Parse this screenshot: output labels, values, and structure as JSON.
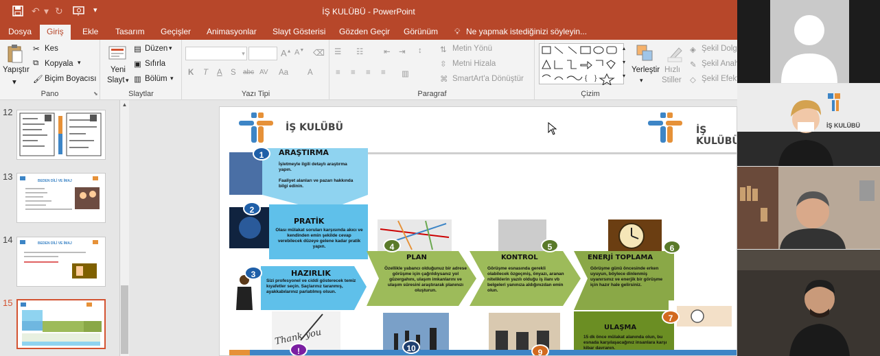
{
  "window": {
    "title": "İŞ KULÜBÜ - PowerPoint"
  },
  "tabs": [
    "Dosya",
    "Giriş",
    "Ekle",
    "Tasarım",
    "Geçişler",
    "Animasyonlar",
    "Slayt Gösterisi",
    "Gözden Geçir",
    "Görünüm"
  ],
  "tell_me": "Ne yapmak istediğinizi söyleyin...",
  "ribbon": {
    "pano": {
      "label": "Pano",
      "paste": "Yapıştır",
      "cut": "Kes",
      "copy": "Kopyala",
      "format_painter": "Biçim Boyacısı"
    },
    "slaytlar": {
      "label": "Slaytlar",
      "new_slide_1": "Yeni",
      "new_slide_2": "Slayt",
      "layout": "Düzen",
      "reset": "Sıfırla",
      "section": "Bölüm"
    },
    "yazi_tipi": {
      "label": "Yazı Tipi",
      "bold": "K",
      "italic": "T",
      "underline": "A",
      "shadow": "S",
      "strike": "abc",
      "spacing": "AV",
      "case": "Aa",
      "font_color": "A"
    },
    "paragraf": {
      "label": "Paragraf",
      "text_direction": "Metin Yönü",
      "align_text": "Metni Hizala",
      "smartart": "SmartArt'a Dönüştür"
    },
    "cizim": {
      "label": "Çizim",
      "arrange": "Yerleştir",
      "quick_styles_1": "Hızlı",
      "quick_styles_2": "Stiller",
      "fill": "Şekil Dolgu",
      "outline": "Şekil Anah",
      "effects": "Şekil Efekt"
    }
  },
  "thumbnails": [
    {
      "num": "12"
    },
    {
      "num": "13",
      "title": "BEDEN DİLİ VE İMAJ"
    },
    {
      "num": "14",
      "title": "BEDEN DİLİ VE İMAJ"
    },
    {
      "num": "15"
    }
  ],
  "slide": {
    "logo_text": "İŞ KULÜBÜ",
    "steps": [
      {
        "num": "1",
        "title": "ARAŞTIRMA",
        "body": "İşletmeyle ilgili detaylı araştırma yapın.\n\nFaaliyet alanları ve pazarı hakkında bilgi edinin."
      },
      {
        "num": "2",
        "title": "PRATİK",
        "body": "Olası mülakat soruları karşısında akıcı ve kendinden emin şekilde cevap verebilecek düzeye gelene kadar pratik yapın."
      },
      {
        "num": "3",
        "title": "HAZIRLIK",
        "body": "Sizi profesyonel ve ciddi gösterecek temiz kıyafetler seçin. Saçlarınız taranmış, ayakkabılarınız parlatılmış olsun."
      },
      {
        "num": "4",
        "title": "PLAN",
        "body": "Özellikle yabancı olduğunuz bir adrese görüşme için çağrıldıysanız yol güzergahını, ulaşım imkanlarını ve ulaşım süresini araştırarak planınızı oluşturun."
      },
      {
        "num": "5",
        "title": "KONTROL",
        "body": "Görüşme esnasında gerekli olabilecek özgeçmiş, önyazı, aranan niteliklerin yazılı olduğu iş ilanı vb belgeleri yanınıza aldığınızdan emin olun."
      },
      {
        "num": "6",
        "title": "ENERJİ TOPLAMA",
        "body": "Görüşme günü öncesinde erken uyuyun, böylece dinlenmiş uyanırsınız ve enerjik bir görüşme için hazır hale gelirsiniz."
      },
      {
        "num": "7",
        "title": "ULAŞMA",
        "body": "15 dk önce mülakat alanında olun, bu esnada karşılaşacağınız insanlara karşı kibar davranın."
      }
    ],
    "bottom_circles": [
      "!",
      "10",
      "9"
    ],
    "thank_you": "Thank you"
  },
  "video_panels": [
    {
      "caption": ""
    },
    {
      "caption": "İŞ KULÜBÜ"
    },
    {
      "caption": ""
    },
    {
      "caption": ""
    }
  ],
  "colors": {
    "accent": "#b7472a",
    "ribbon_bg": "#f3f3f3",
    "step_blue": "#8fd3f0",
    "step_green": "#9dbb5a",
    "circle_blue": "#1f5fa8",
    "circle_green": "#5a7a2a",
    "circle_orange": "#d2691e"
  }
}
